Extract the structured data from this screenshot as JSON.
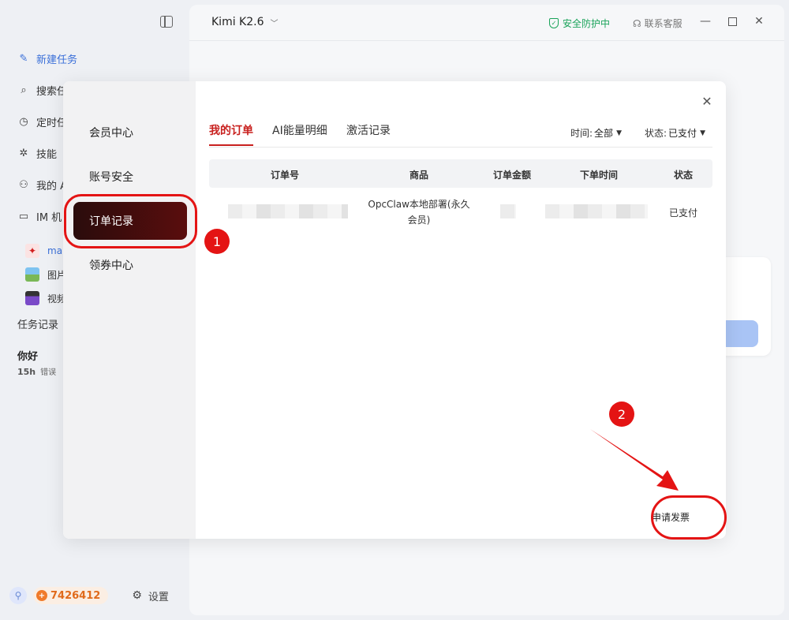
{
  "sidebar": {
    "new_task": "新建任务",
    "items": [
      {
        "label": "搜索任务",
        "icon": "search-icon"
      },
      {
        "label": "定时任务",
        "icon": "clock-icon"
      },
      {
        "label": "技能",
        "icon": "puzzle-icon"
      },
      {
        "label": "我的 A",
        "icon": "group-icon"
      },
      {
        "label": "IM 机",
        "icon": "chat-icon"
      }
    ],
    "sub_items": [
      {
        "label": "mai",
        "icon": "lobster-icon"
      },
      {
        "label": "图片",
        "icon": "image-icon"
      },
      {
        "label": "视频",
        "icon": "clapper-icon"
      }
    ],
    "task_history_label": "任务记录",
    "history": {
      "title": "你好",
      "time": "15h",
      "status": "错误"
    },
    "points": "7426412",
    "settings_label": "设置"
  },
  "titlebar": {
    "model": "Kimi K2.6",
    "security": "安全防护中",
    "support": "联系客服"
  },
  "modal": {
    "nav": [
      {
        "label": "会员中心",
        "active": false
      },
      {
        "label": "账号安全",
        "active": false
      },
      {
        "label": "订单记录",
        "active": true
      },
      {
        "label": "领券中心",
        "active": false
      }
    ],
    "tabs": [
      {
        "label": "我的订单",
        "active": true
      },
      {
        "label": "AI能量明细",
        "active": false
      },
      {
        "label": "激活记录",
        "active": false
      }
    ],
    "filters": {
      "time_label": "时间:",
      "time_value": "全部",
      "status_label": "状态:",
      "status_value": "已支付"
    },
    "table": {
      "headers": [
        "订单号",
        "商品",
        "订单金额",
        "下单时间",
        "状态"
      ],
      "rows": [
        {
          "product_line1": "OpcClaw本地部署(永久",
          "product_line2": "会员)",
          "status": "已支付"
        }
      ]
    },
    "invoice_label": "申请发票"
  },
  "annotations": {
    "badge1": "1",
    "badge2": "2",
    "color": "#e41414"
  },
  "colors": {
    "accent_red": "#c8201e",
    "link_blue": "#3a6fd8",
    "safe_green": "#1aa35a",
    "points_orange": "#e06a1b"
  }
}
